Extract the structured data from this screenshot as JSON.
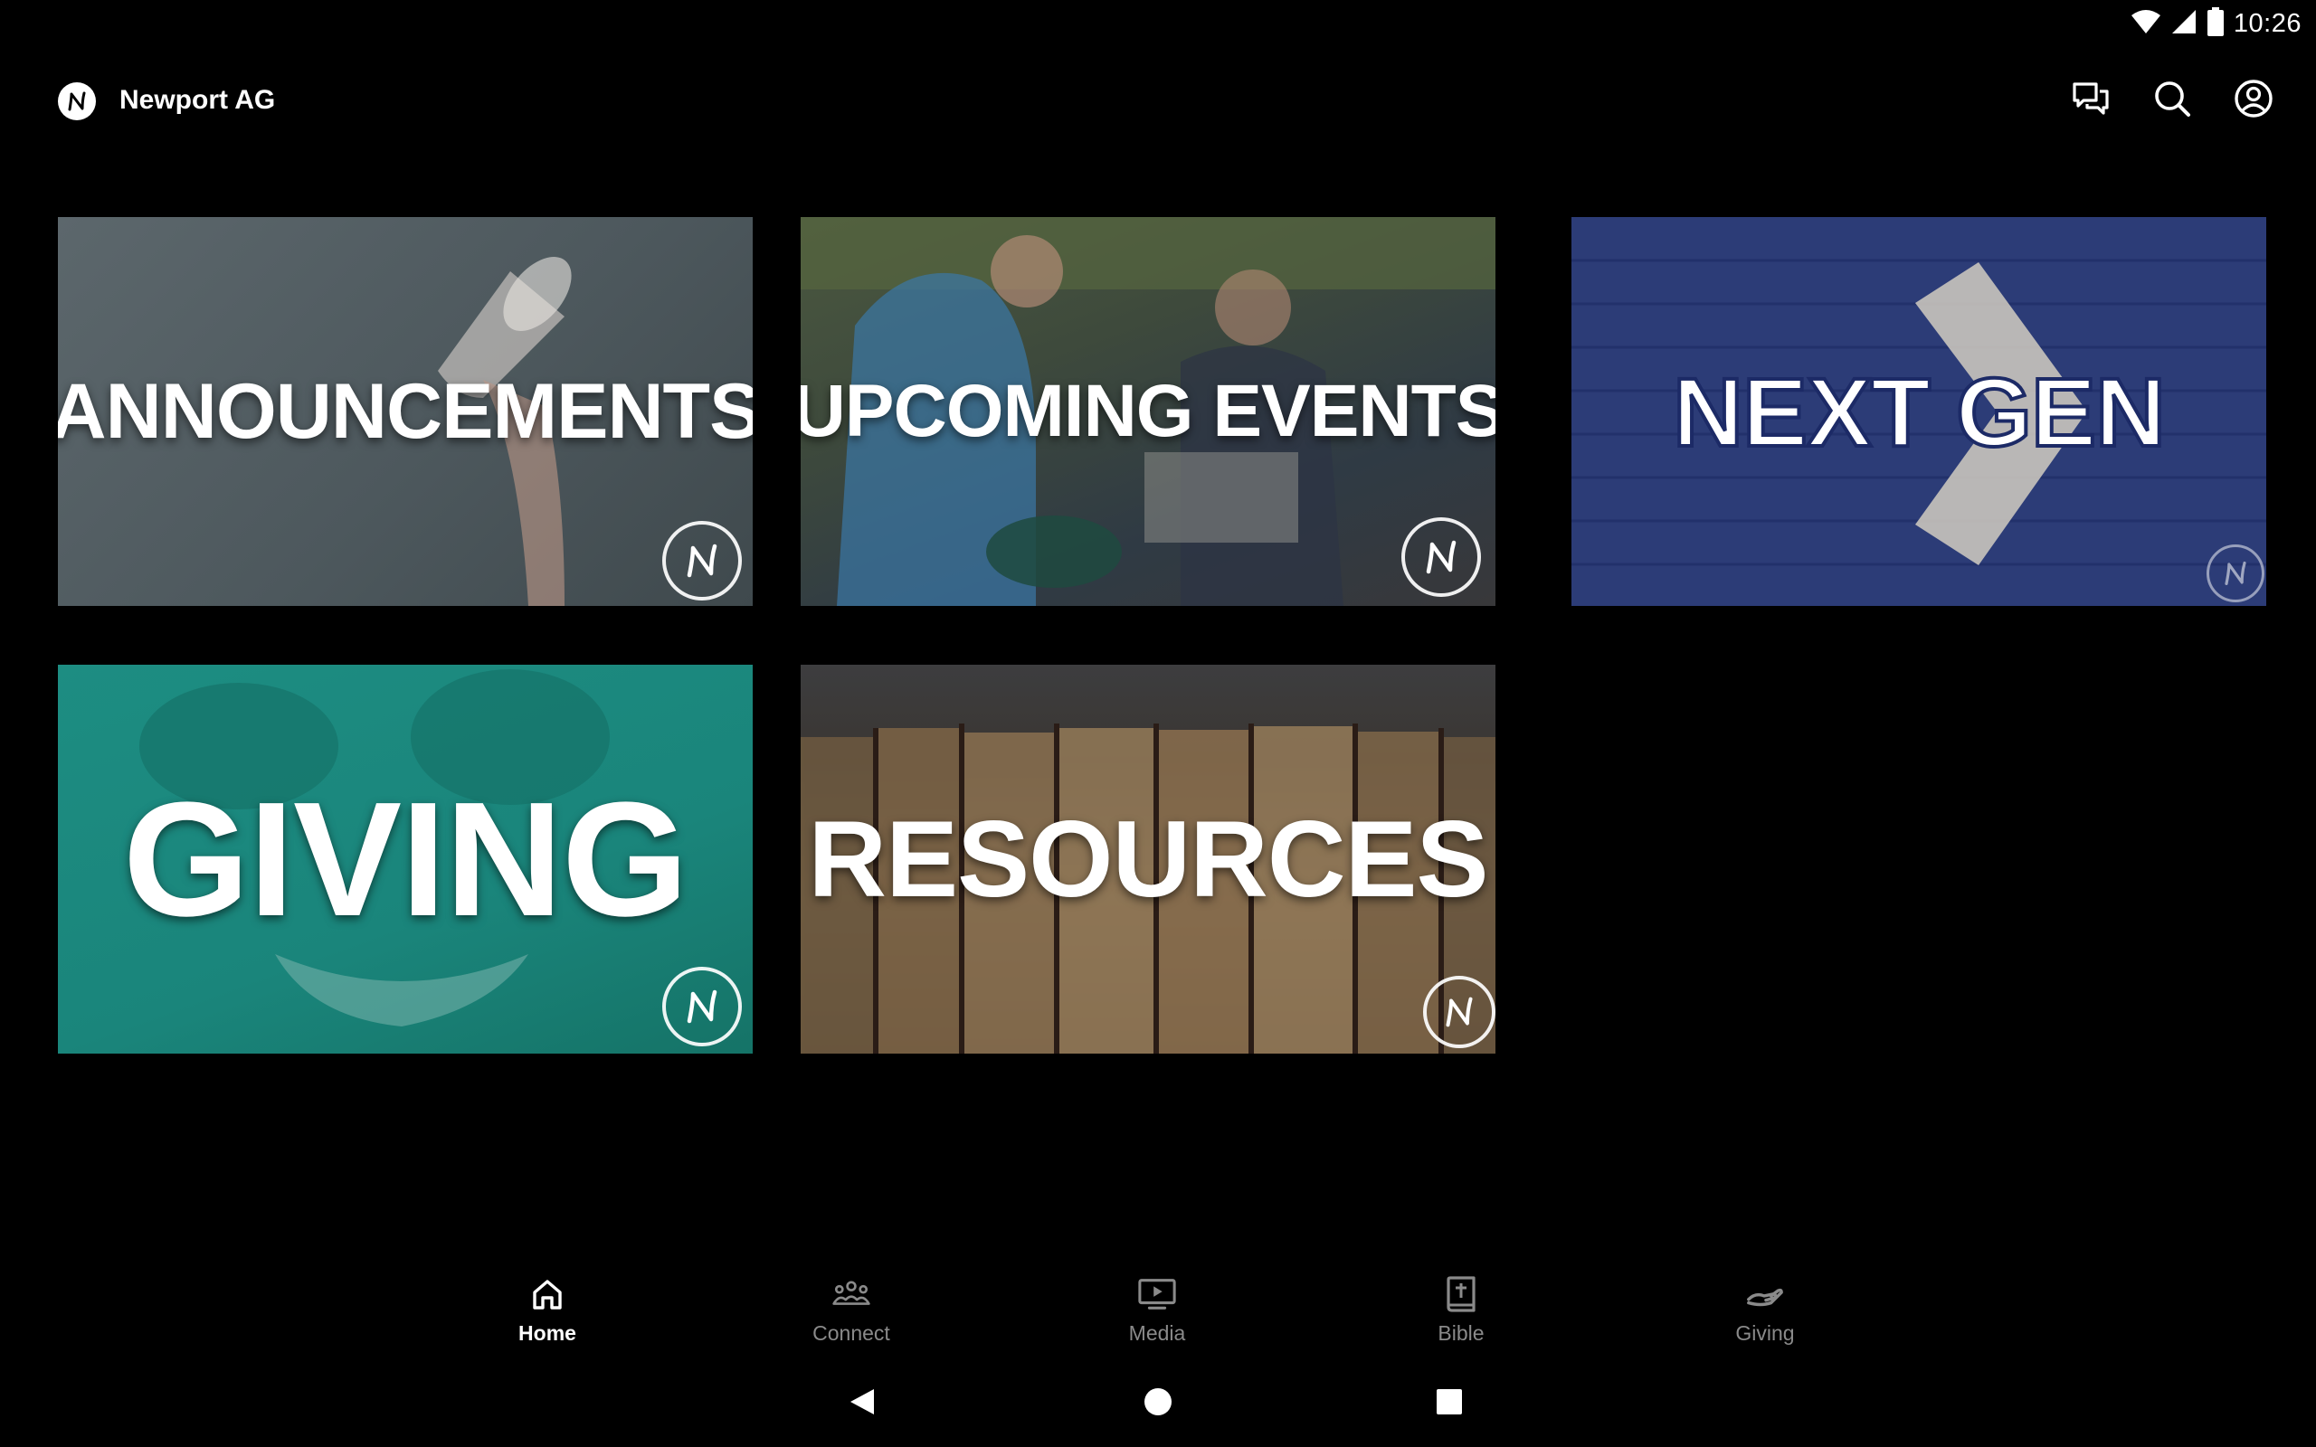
{
  "status_bar": {
    "time": "10:26"
  },
  "app_bar": {
    "title": "Newport AG",
    "logo_letter": "N"
  },
  "tiles": [
    {
      "label": "ANNOUNCEMENTS"
    },
    {
      "label": "UPCOMING EVENTS"
    },
    {
      "label": "NEXT GEN"
    },
    {
      "label": "GIVING"
    },
    {
      "label": "RESOURCES"
    }
  ],
  "bottom_nav": {
    "items": [
      {
        "label": "Home",
        "icon": "home-icon",
        "active": true
      },
      {
        "label": "Connect",
        "icon": "people-icon",
        "active": false
      },
      {
        "label": "Media",
        "icon": "tv-play-icon",
        "active": false
      },
      {
        "label": "Bible",
        "icon": "bible-icon",
        "active": false
      },
      {
        "label": "Giving",
        "icon": "giving-hand-icon",
        "active": false
      }
    ]
  },
  "colors": {
    "background": "#000000",
    "nav_active": "#ffffff",
    "nav_inactive": "#8a8a8a",
    "giving_teal": "#1a857b",
    "nextgen_blue": "#2c3c77"
  }
}
